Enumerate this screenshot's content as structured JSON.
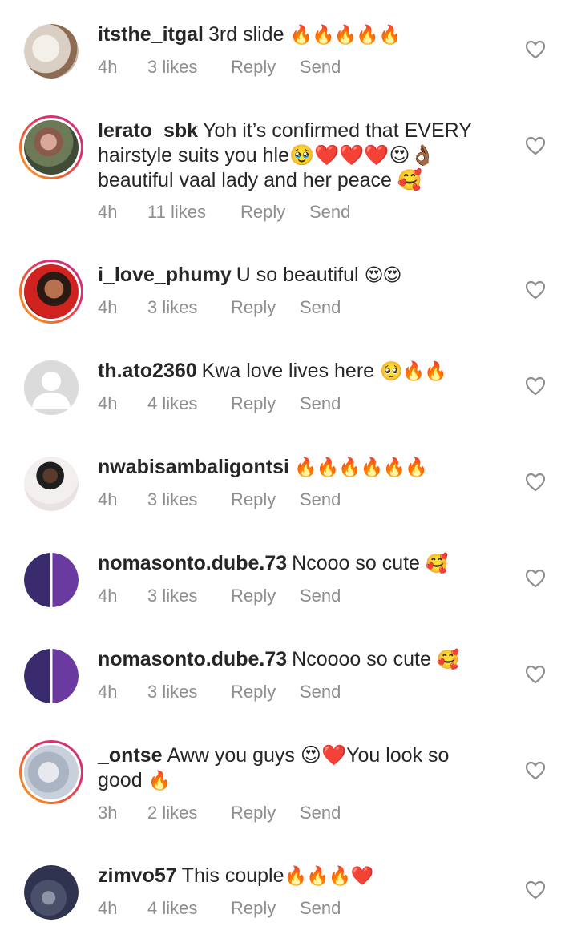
{
  "actions": {
    "reply": "Reply",
    "send": "Send"
  },
  "colors": {
    "text": "#262626",
    "secondary": "#8e8e8e",
    "story_ring_start": "#f9a825",
    "story_ring_end": "#c13584"
  },
  "comments": [
    {
      "username": "itsthe_itgal",
      "text": "3rd slide",
      "emoji": "🔥🔥🔥🔥🔥",
      "time": "4h",
      "likes": "3 likes",
      "avatar": "photo-avatar",
      "like_icon": "heart-outline-icon"
    },
    {
      "username": "lerato_sbk",
      "text": "Yoh it’s confirmed that EVERY hairstyle suits you hle🥹❤️❤️❤️😍👌🏾 beautiful vaal lady and her peace 🥰",
      "emoji": "",
      "time": "4h",
      "likes": "11 likes",
      "avatar": "story-avatar",
      "like_icon": "heart-outline-icon"
    },
    {
      "username": "i_love_phumy",
      "text": "U so beautiful",
      "emoji": "😍😍",
      "time": "4h",
      "likes": "3 likes",
      "avatar": "story-avatar",
      "like_icon": "heart-outline-icon"
    },
    {
      "username": "th.ato2360",
      "text": "Kwa love lives here",
      "emoji": "🥺🔥🔥",
      "time": "4h",
      "likes": "4 likes",
      "avatar": "default-avatar",
      "like_icon": "heart-outline-icon"
    },
    {
      "username": "nwabisambaligontsi",
      "text": "",
      "emoji": "🔥🔥🔥🔥🔥🔥",
      "time": "4h",
      "likes": "3 likes",
      "avatar": "photo-avatar",
      "like_icon": "heart-outline-icon"
    },
    {
      "username": "nomasonto.dube.73",
      "text": "Ncooo so cute",
      "emoji": "🥰",
      "time": "4h",
      "likes": "3 likes",
      "avatar": "photo-avatar",
      "like_icon": "heart-outline-icon"
    },
    {
      "username": "nomasonto.dube.73",
      "text": "Ncoooo so cute",
      "emoji": "🥰",
      "time": "4h",
      "likes": "3 likes",
      "avatar": "photo-avatar",
      "like_icon": "heart-outline-icon"
    },
    {
      "username": "_ontse",
      "text": "Aww you guys 😍❤️You look so good",
      "emoji": "🔥",
      "time": "3h",
      "likes": "2 likes",
      "avatar": "story-avatar",
      "like_icon": "heart-outline-icon"
    },
    {
      "username": "zimvo57",
      "text": "This couple",
      "emoji": "🔥🔥🔥❤️",
      "time": "4h",
      "likes": "4 likes",
      "avatar": "photo-avatar",
      "like_icon": "heart-outline-icon"
    }
  ]
}
